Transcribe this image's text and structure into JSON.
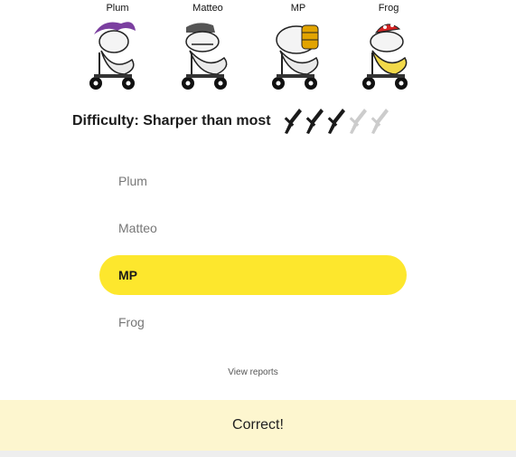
{
  "characters": [
    {
      "name": "Plum",
      "icon": "plum-character-icon",
      "accent": "#7b3fa0"
    },
    {
      "name": "Matteo",
      "icon": "matteo-character-icon",
      "accent": "#555555"
    },
    {
      "name": "MP",
      "icon": "mp-character-icon",
      "accent": "#e2a400"
    },
    {
      "name": "Frog",
      "icon": "frog-character-icon",
      "accent": "#d32222"
    }
  ],
  "difficulty": {
    "label": "Difficulty: Sharper than most",
    "rating": 3,
    "max": 5,
    "icon": "knife-icon"
  },
  "options": [
    {
      "label": "Plum",
      "selected": false
    },
    {
      "label": "Matteo",
      "selected": false
    },
    {
      "label": "MP",
      "selected": true
    },
    {
      "label": "Frog",
      "selected": false
    }
  ],
  "view_reports_label": "View reports",
  "result_text": "Correct!",
  "colors": {
    "selected_bg": "#fde72d",
    "result_bg": "#fdf6cf",
    "knife_active": "#1a1a1a",
    "knife_inactive": "#cccccc"
  }
}
